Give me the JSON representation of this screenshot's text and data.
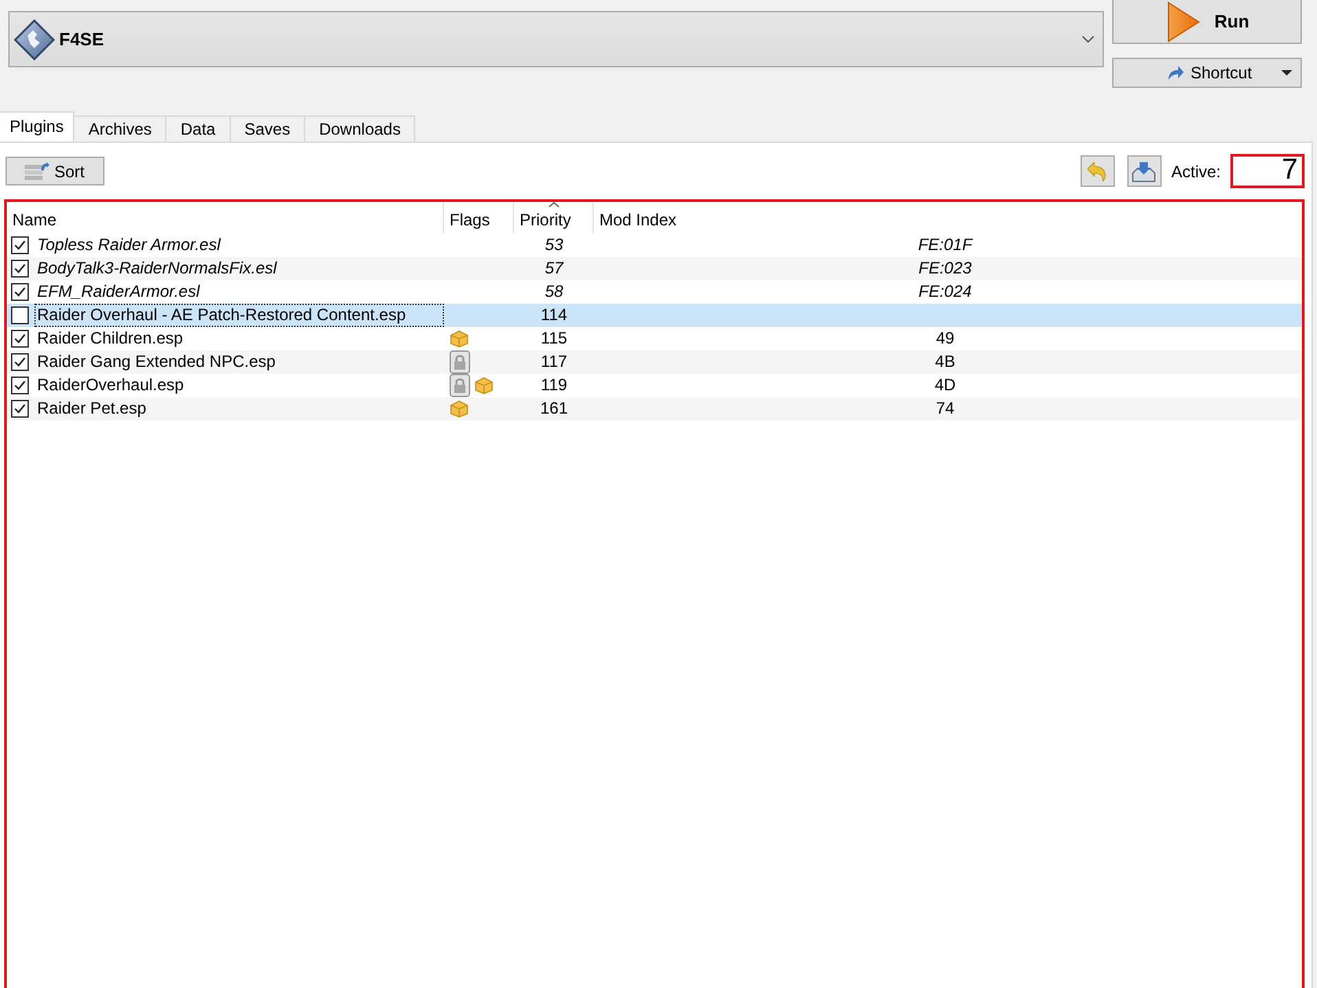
{
  "profile": {
    "name": "F4SE"
  },
  "run_button": {
    "label": "Run"
  },
  "shortcut_button": {
    "label": "Shortcut"
  },
  "tabs": [
    {
      "label": "Plugins",
      "selected": true
    },
    {
      "label": "Archives",
      "selected": false
    },
    {
      "label": "Data",
      "selected": false
    },
    {
      "label": "Saves",
      "selected": false
    },
    {
      "label": "Downloads",
      "selected": false
    }
  ],
  "toolbar": {
    "sort_button": "Sort",
    "active": {
      "label": "Active:",
      "value": "7"
    }
  },
  "table": {
    "columns": [
      {
        "label": "Name",
        "sorted": false
      },
      {
        "label": "Flags",
        "sorted": false
      },
      {
        "label": "Priority",
        "sorted": true
      },
      {
        "label": "Mod Index",
        "sorted": false
      }
    ],
    "rows": [
      {
        "name": "Topless Raider Armor.esl",
        "checked": true,
        "light": true,
        "selected": false,
        "priority": "53",
        "mod_index": "FE:01F"
      },
      {
        "name": "BodyTalk3-RaiderNormalsFix.esl",
        "checked": true,
        "light": true,
        "selected": false,
        "priority": "57",
        "mod_index": "FE:023"
      },
      {
        "name": "EFM_RaiderArmor.esl",
        "checked": true,
        "light": true,
        "selected": false,
        "priority": "58",
        "mod_index": "FE:024"
      },
      {
        "name": "Raider Overhaul - AE Patch-Restored Content.esp",
        "checked": false,
        "light": false,
        "selected": true,
        "priority": "114"
      },
      {
        "name": "Raider Children.esp",
        "checked": true,
        "light": false,
        "selected": false,
        "flags": [
          {
            "kind": "archive"
          }
        ],
        "priority": "115",
        "mod_index": "49"
      },
      {
        "name": "Raider Gang Extended NPC.esp",
        "checked": true,
        "light": false,
        "selected": false,
        "flags": [
          {
            "kind": "lock"
          }
        ],
        "priority": "117",
        "mod_index": "4B"
      },
      {
        "name": "RaiderOverhaul.esp",
        "checked": true,
        "light": false,
        "selected": false,
        "flags": [
          {
            "kind": "lock"
          },
          {
            "kind": "archive"
          }
        ],
        "priority": "119",
        "mod_index": "4D"
      },
      {
        "name": "Raider Pet.esp",
        "checked": true,
        "light": false,
        "selected": false,
        "flags": [
          {
            "kind": "archive"
          }
        ],
        "priority": "161",
        "mod_index": "74"
      }
    ]
  }
}
